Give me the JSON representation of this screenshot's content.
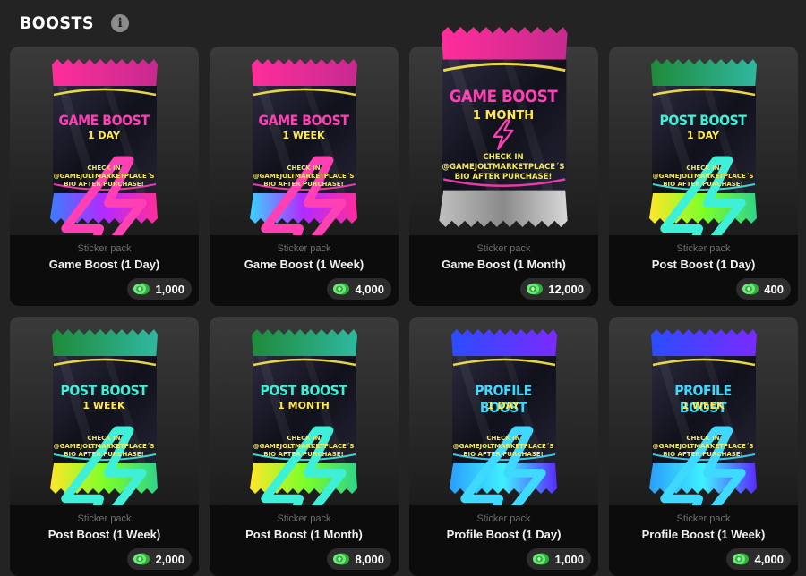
{
  "header": {
    "title": "BOOSTS",
    "info_icon": "info-icon"
  },
  "currency_icon": "coin-icon",
  "cards": [
    {
      "pack_line1": "GAME BOOST",
      "pack_line2": "1 DAY",
      "check_line1": "CHECK IN",
      "check_line2": "@GAMEJOLTMARKETPLACE´S",
      "check_line3": "BIO AFTER PURCHASE!",
      "type": "Sticker pack",
      "name": "Game Boost (1 Day)",
      "price": "1,000",
      "title_color": "#ff3fb4",
      "sub_color": "#ffe94a",
      "bolt_color": "#ff3fb4",
      "top_colors": [
        "#ff2d9b",
        "#c72a8f"
      ],
      "bottom_colors": [
        "#3b7dff",
        "#b42aff",
        "#ff2d9b"
      ]
    },
    {
      "pack_line1": "GAME BOOST",
      "pack_line2": "1 WEEK",
      "check_line1": "CHECK IN",
      "check_line2": "@GAMEJOLTMARKETPLACE´S",
      "check_line3": "BIO AFTER PURCHASE!",
      "type": "Sticker pack",
      "name": "Game Boost (1 Week)",
      "price": "4,000",
      "title_color": "#ff3fb4",
      "sub_color": "#ffe94a",
      "bolt_color": "#ff3fb4",
      "top_colors": [
        "#ff2d9b",
        "#c72a8f"
      ],
      "bottom_colors": [
        "#3bd2ff",
        "#b42aff",
        "#ff2d9b"
      ]
    },
    {
      "pack_line1": "GAME BOOST",
      "pack_line2": "1 MONTH",
      "check_line1": "CHECK IN",
      "check_line2": "@GAMEJOLTMARKETPLACE´S",
      "check_line3": "BIO AFTER PURCHASE!",
      "type": "Sticker pack",
      "name": "Game Boost (1 Month)",
      "price": "12,000",
      "title_color": "#ff3fb4",
      "sub_color": "#ffe94a",
      "bolt_color": "#ff3fb4",
      "top_colors": [
        "#ff2d9b",
        "#c72a8f"
      ],
      "bottom_colors": [
        "#c0c0c0",
        "#8a8a8a",
        "#d8d8d8"
      ]
    },
    {
      "pack_line1": "POST BOOST",
      "pack_line2": "1 DAY",
      "check_line1": "CHECK IN",
      "check_line2": "@GAMEJOLTMARKETPLACE´S",
      "check_line3": "BIO AFTER PURCHASE!",
      "type": "Sticker pack",
      "name": "Post Boost (1 Day)",
      "price": "400",
      "title_color": "#3ff0d8",
      "sub_color": "#ffe94a",
      "bolt_color": "#3ff0d8",
      "top_colors": [
        "#1f8a3a",
        "#2fb8a0"
      ],
      "bottom_colors": [
        "#ffe62a",
        "#7dff2a",
        "#2fd48a"
      ]
    },
    {
      "pack_line1": "POST BOOST",
      "pack_line2": "1 WEEK",
      "check_line1": "CHECK IN",
      "check_line2": "@GAMEJOLTMARKETPLACE´S",
      "check_line3": "BIO AFTER PURCHASE!",
      "type": "Sticker pack",
      "name": "Post Boost (1 Week)",
      "price": "2,000",
      "title_color": "#3ff0d8",
      "sub_color": "#ffe94a",
      "bolt_color": "#3ff0d8",
      "top_colors": [
        "#1f8a3a",
        "#2fb8a0"
      ],
      "bottom_colors": [
        "#ffe62a",
        "#7dff2a",
        "#2fd48a"
      ]
    },
    {
      "pack_line1": "POST BOOST",
      "pack_line2": "1 MONTH",
      "check_line1": "CHECK IN",
      "check_line2": "@GAMEJOLTMARKETPLACE´S",
      "check_line3": "BIO AFTER PURCHASE!",
      "type": "Sticker pack",
      "name": "Post Boost (1 Month)",
      "price": "8,000",
      "title_color": "#3ff0d8",
      "sub_color": "#ffe94a",
      "bolt_color": "#3ff0d8",
      "top_colors": [
        "#1f8a3a",
        "#2fb8a0"
      ],
      "bottom_colors": [
        "#ffe62a",
        "#7dff2a",
        "#2fd48a"
      ]
    },
    {
      "pack_line1": "PROFILE BOOST",
      "pack_line2": "1 DAY",
      "check_line1": "CHECK IN",
      "check_line2": "@GAMEJOLTMARKETPLACE´S",
      "check_line3": "BIO AFTER PURCHASE!",
      "type": "Sticker pack",
      "name": "Profile Boost (1 Day)",
      "price": "1,000",
      "title_color": "#3fd8ff",
      "sub_color": "#ffe94a",
      "bolt_color": "#3fd8ff",
      "top_colors": [
        "#2a4dff",
        "#7a2aff"
      ],
      "bottom_colors": [
        "#2a9dff",
        "#3ff0ff",
        "#5a2aff"
      ]
    },
    {
      "pack_line1": "PROFILE BOOST",
      "pack_line2": "1 WEEK",
      "check_line1": "CHECK IN",
      "check_line2": "@GAMEJOLTMARKETPLACE´S",
      "check_line3": "BIO AFTER PURCHASE!",
      "type": "Sticker pack",
      "name": "Profile Boost (1 Week)",
      "price": "4,000",
      "title_color": "#3fd8ff",
      "sub_color": "#ffe94a",
      "bolt_color": "#3fd8ff",
      "top_colors": [
        "#2a4dff",
        "#7a2aff"
      ],
      "bottom_colors": [
        "#2a9dff",
        "#3ff0ff",
        "#5a2aff"
      ]
    }
  ]
}
